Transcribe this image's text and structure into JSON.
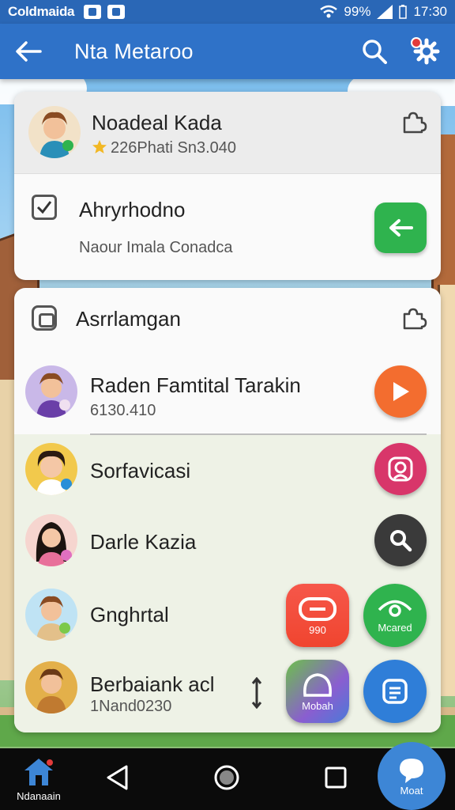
{
  "status_bar": {
    "carrier": "Coldmaida",
    "battery": "99%",
    "time": "17:30"
  },
  "app_bar": {
    "title": "Nta Metaroo"
  },
  "card_profile": {
    "name": "Noadeal Kada",
    "rating_text": "226Phati Sn3.040"
  },
  "card_task": {
    "title": "Ahryrhodno",
    "subtitle": "Naour Imala Conadca"
  },
  "card_list": {
    "header": "Asrrlamgan",
    "items": [
      {
        "name": "Raden Famtital Tarakin",
        "sub": "6130.410"
      },
      {
        "name": "Sorfavicasi"
      },
      {
        "name": "Darle Kazia"
      },
      {
        "name": "Gnghrtal"
      },
      {
        "name": "Berbaiank acl",
        "sub": "1Nand0230"
      }
    ],
    "tiles": {
      "red": "990",
      "green": "Mcared",
      "purple": "Mobah"
    }
  },
  "nav": {
    "home_label": "Ndanaain",
    "fab_label": "Moat"
  },
  "colors": {
    "appbar": "#2f72c8",
    "statusbar": "#2a67b6",
    "green": "#2fb34e",
    "orange": "#f36d2f",
    "pink": "#d8366a"
  }
}
